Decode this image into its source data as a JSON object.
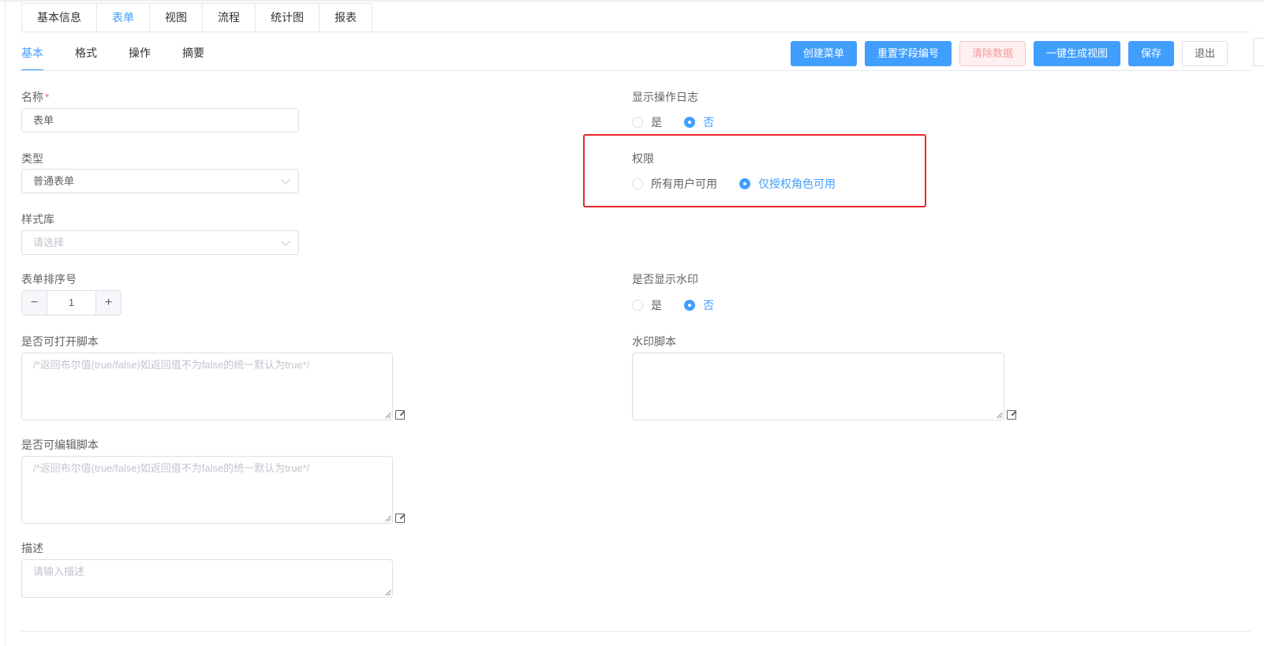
{
  "top_tabs": [
    "基本信息",
    "表单",
    "视图",
    "流程",
    "统计图",
    "报表"
  ],
  "top_tabs_active": "表单",
  "sub_tabs": [
    "基本",
    "格式",
    "操作",
    "摘要"
  ],
  "sub_tabs_active": "基本",
  "actions": {
    "create_menu": "创建菜单",
    "reset_field_numbers": "重置字段编号",
    "clear_data": "清除数据",
    "generate_view": "一键生成视图",
    "save": "保存",
    "exit": "退出"
  },
  "form": {
    "name": {
      "label": "名称",
      "required_mark": "*",
      "value": "表单"
    },
    "type": {
      "label": "类型",
      "value": "普通表单"
    },
    "style_lib": {
      "label": "样式库",
      "placeholder": "请选择"
    },
    "sort_order": {
      "label": "表单排序号",
      "value": "1",
      "minus": "−",
      "plus": "+"
    },
    "open_script": {
      "label": "是否可打开脚本",
      "placeholder": "/*返回布尔值(true/false)如返回值不为false的统一默认为true*/"
    },
    "edit_script": {
      "label": "是否可编辑脚本",
      "placeholder": "/*返回布尔值(true/false)如返回值不为false的统一默认为true*/"
    },
    "description": {
      "label": "描述",
      "placeholder": "请输入描述"
    },
    "show_log": {
      "label": "显示操作日志",
      "options": [
        "是",
        "否"
      ],
      "selected": "否"
    },
    "permission": {
      "label": "权限",
      "options": [
        "所有用户可用",
        "仅授权角色可用"
      ],
      "selected": "仅授权角色可用"
    },
    "watermark": {
      "label": "是否显示水印",
      "options": [
        "是",
        "否"
      ],
      "selected": "否"
    },
    "watermark_script": {
      "label": "水印脚本",
      "placeholder": ""
    }
  },
  "colors": {
    "primary": "#409eff",
    "highlight": "#e8262b",
    "required": "#f56c6c"
  }
}
